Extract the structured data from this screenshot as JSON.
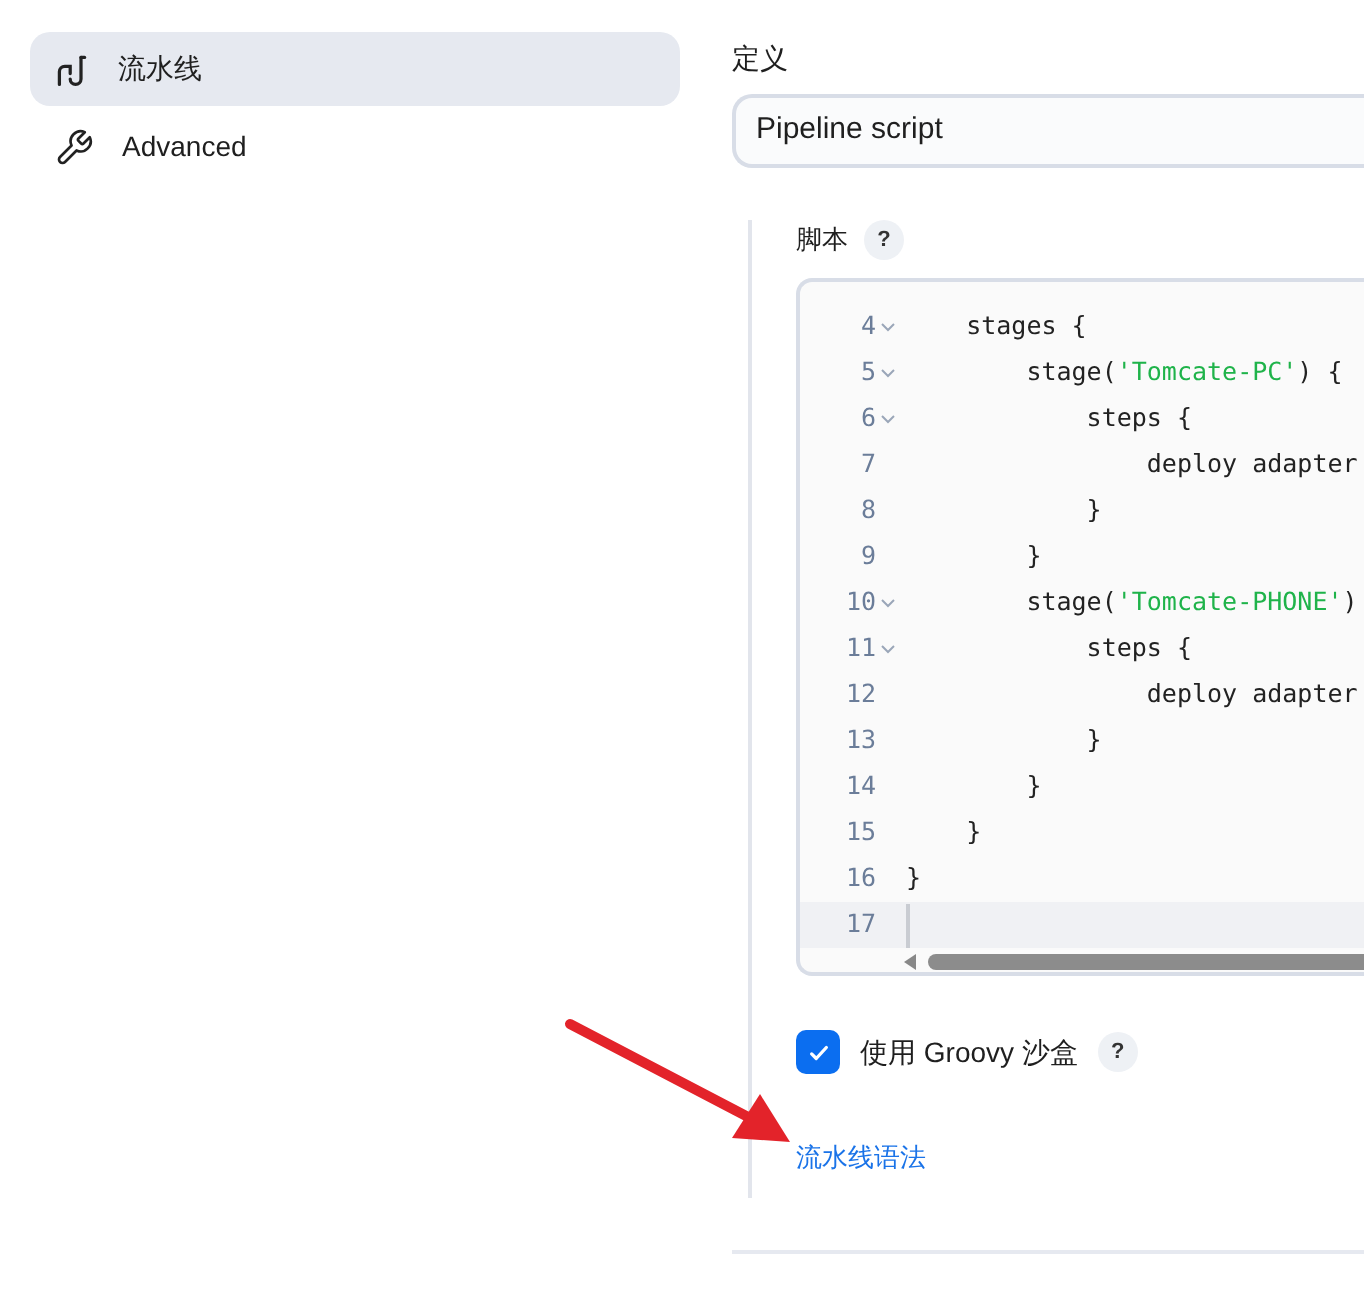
{
  "sidebar": {
    "items": [
      {
        "label": "流水线",
        "selected": true
      },
      {
        "label": "Advanced",
        "selected": false
      }
    ]
  },
  "definition": {
    "label": "定义",
    "value": "Pipeline script"
  },
  "script": {
    "label": "脚本",
    "help": "?",
    "lines": [
      {
        "number": "4",
        "foldable": true,
        "current": false,
        "parts": [
          {
            "kind": "code",
            "text": "    stages {"
          }
        ]
      },
      {
        "number": "5",
        "foldable": true,
        "current": false,
        "parts": [
          {
            "kind": "code",
            "text": "        stage("
          },
          {
            "kind": "string",
            "text": "'Tomcate-PC'"
          },
          {
            "kind": "code",
            "text": ") {"
          }
        ]
      },
      {
        "number": "6",
        "foldable": true,
        "current": false,
        "parts": [
          {
            "kind": "code",
            "text": "            steps {"
          }
        ]
      },
      {
        "number": "7",
        "foldable": false,
        "current": false,
        "parts": [
          {
            "kind": "code",
            "text": "                deploy adapter"
          }
        ]
      },
      {
        "number": "8",
        "foldable": false,
        "current": false,
        "parts": [
          {
            "kind": "code",
            "text": "            }"
          }
        ]
      },
      {
        "number": "9",
        "foldable": false,
        "current": false,
        "parts": [
          {
            "kind": "code",
            "text": "        }"
          }
        ]
      },
      {
        "number": "10",
        "foldable": true,
        "current": false,
        "parts": [
          {
            "kind": "code",
            "text": "        stage("
          },
          {
            "kind": "string",
            "text": "'Tomcate-PHONE'"
          },
          {
            "kind": "code",
            "text": ")"
          }
        ]
      },
      {
        "number": "11",
        "foldable": true,
        "current": false,
        "parts": [
          {
            "kind": "code",
            "text": "            steps {"
          }
        ]
      },
      {
        "number": "12",
        "foldable": false,
        "current": false,
        "parts": [
          {
            "kind": "code",
            "text": "                deploy adapter"
          }
        ]
      },
      {
        "number": "13",
        "foldable": false,
        "current": false,
        "parts": [
          {
            "kind": "code",
            "text": "            }"
          }
        ]
      },
      {
        "number": "14",
        "foldable": false,
        "current": false,
        "parts": [
          {
            "kind": "code",
            "text": "        }"
          }
        ]
      },
      {
        "number": "15",
        "foldable": false,
        "current": false,
        "parts": [
          {
            "kind": "code",
            "text": "    }"
          }
        ]
      },
      {
        "number": "16",
        "foldable": false,
        "current": false,
        "parts": [
          {
            "kind": "code",
            "text": "}"
          }
        ]
      },
      {
        "number": "17",
        "foldable": false,
        "current": true
      }
    ]
  },
  "sandbox": {
    "label": "使用 Groovy 沙盒",
    "checked": true,
    "help": "?"
  },
  "syntax_link": "流水线语法"
}
